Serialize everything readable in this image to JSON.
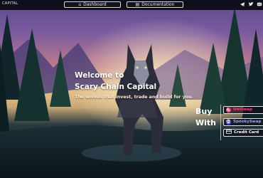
{
  "brand": {
    "text": "CAPITAL"
  },
  "nav": {
    "dashboard_label": "Dashboard",
    "documentation_label": "Documentation"
  },
  "social": {
    "icons": [
      "telegram-icon",
      "twitter-icon",
      "discord-icon"
    ]
  },
  "hero": {
    "title_line1": "Welcome to",
    "title_line2": "Scary Chain Capital",
    "tagline": "The wolves that invest, trade and build for you."
  },
  "buy": {
    "line1": "Buy",
    "line2": "With",
    "options": [
      {
        "label": "UniSwap"
      },
      {
        "label": "SpookySwap"
      },
      {
        "label": "Credit Card"
      }
    ]
  },
  "colors": {
    "uniswap": "#ff3f87",
    "spookyswap": "#8ea6ff"
  }
}
